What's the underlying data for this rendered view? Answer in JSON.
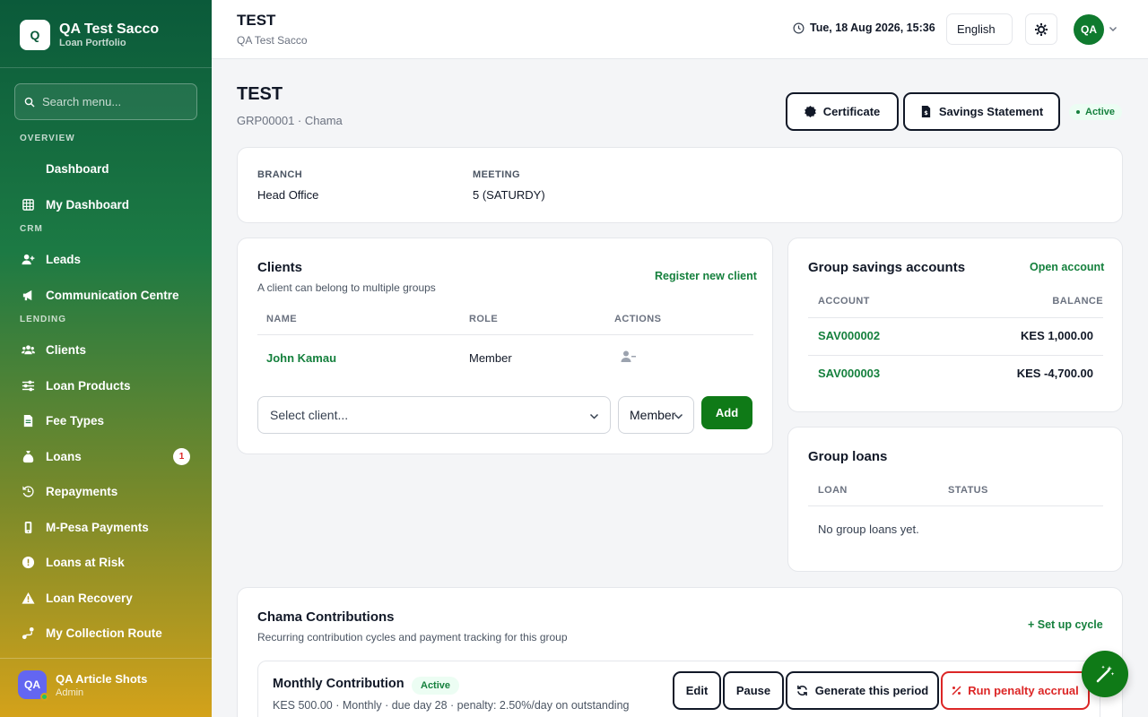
{
  "sidebar": {
    "brand_initials": "Q",
    "brand_title": "QA Test Sacco",
    "brand_subtitle": "Loan Portfolio",
    "search_placeholder": "Search menu...",
    "sections": {
      "overview": "OVERVIEW",
      "crm": "CRM",
      "lending": "LENDING"
    },
    "items": {
      "dashboard": "Dashboard",
      "my_dashboard": "My Dashboard",
      "leads": "Leads",
      "communication": "Communication Centre",
      "clients": "Clients",
      "loan_products": "Loan Products",
      "fee_types": "Fee Types",
      "loans": "Loans",
      "loans_badge": "1",
      "repayments": "Repayments",
      "mpesa": "M-Pesa Payments",
      "loans_at_risk": "Loans at Risk",
      "loan_recovery": "Loan Recovery",
      "collection_route": "My Collection Route"
    },
    "user": {
      "initials": "QA",
      "name": "QA Article Shots",
      "role": "Admin"
    }
  },
  "topbar": {
    "title": "TEST",
    "subtitle": "QA Test Sacco",
    "datetime": "Tue, 18 Aug 2026, 15:36",
    "language": "English",
    "avatar_initials": "QA"
  },
  "group": {
    "name": "TEST",
    "meta": "GRP00001 · Chama",
    "certificate_label": "Certificate",
    "statement_label": "Savings Statement",
    "status": "Active",
    "branch_label": "BRANCH",
    "branch_value": "Head Office",
    "meeting_label": "MEETING",
    "meeting_value": "5 (SATURDY)"
  },
  "clients_card": {
    "title": "Clients",
    "subtitle": "A client can belong to multiple groups",
    "register_link": "Register new client",
    "columns": [
      "NAME",
      "ROLE",
      "ACTIONS"
    ],
    "rows": [
      {
        "name": "John Kamau",
        "role": "Member"
      }
    ],
    "select_placeholder": "Select client...",
    "role_select": "Member",
    "add_label": "Add"
  },
  "savings_card": {
    "title": "Group savings accounts",
    "open_link": "Open account",
    "columns": [
      "ACCOUNT",
      "BALANCE"
    ],
    "rows": [
      {
        "account": "SAV000002",
        "balance": "KES 1,000.00"
      },
      {
        "account": "SAV000003",
        "balance": "KES -4,700.00"
      }
    ]
  },
  "loans_card": {
    "title": "Group loans",
    "columns": [
      "LOAN",
      "STATUS"
    ],
    "empty": "No group loans yet."
  },
  "contributions": {
    "title": "Chama Contributions",
    "subtitle": "Recurring contribution cycles and payment tracking for this group",
    "setup_link": "+ Set up cycle",
    "cycle": {
      "name": "Monthly Contribution",
      "status": "Active",
      "details": "KES 500.00 · Monthly · due day 28 · penalty: 2.50%/day on outstanding",
      "edit": "Edit",
      "pause": "Pause",
      "generate": "Generate this period",
      "penalty": "Run penalty accrual"
    }
  }
}
